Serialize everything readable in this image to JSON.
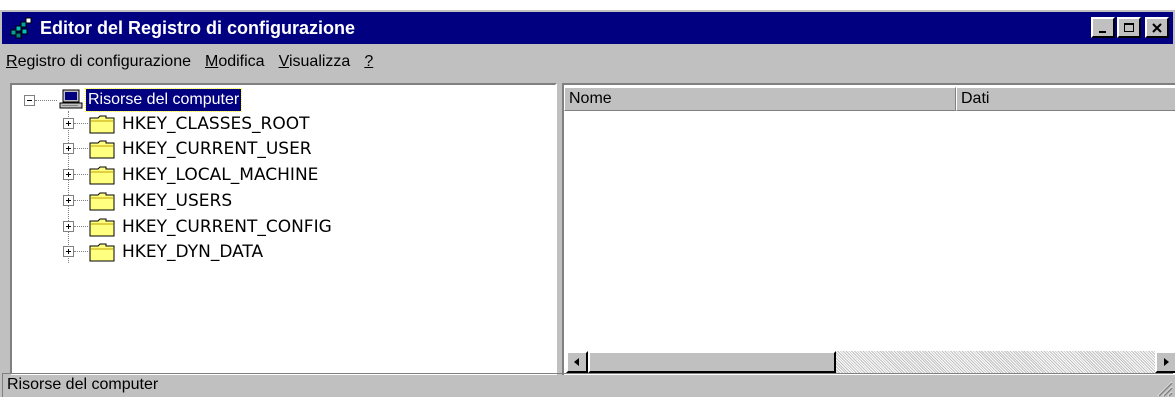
{
  "window": {
    "title": "Editor del Registro di configurazione",
    "icon": "registry-editor-icon"
  },
  "menu": {
    "items": [
      {
        "underline": "R",
        "rest": "egistro di configurazione"
      },
      {
        "underline": "M",
        "rest": "odifica"
      },
      {
        "underline": "V",
        "rest": "isualizza"
      },
      {
        "underline": "?",
        "rest": ""
      }
    ]
  },
  "tree": {
    "root": {
      "label": "Risorse del computer",
      "icon": "computer-icon",
      "expanded": true
    },
    "keys": [
      {
        "label": "HKEY_CLASSES_ROOT",
        "icon": "folder-icon"
      },
      {
        "label": "HKEY_CURRENT_USER",
        "icon": "folder-icon"
      },
      {
        "label": "HKEY_LOCAL_MACHINE",
        "icon": "folder-icon"
      },
      {
        "label": "HKEY_USERS",
        "icon": "folder-icon"
      },
      {
        "label": "HKEY_CURRENT_CONFIG",
        "icon": "folder-icon"
      },
      {
        "label": "HKEY_DYN_DATA",
        "icon": "folder-icon"
      }
    ]
  },
  "list": {
    "columns": [
      "Nome",
      "Dati"
    ]
  },
  "status": {
    "text": "Risorse del computer"
  },
  "colors": {
    "titlebar": "#000080",
    "face": "#c0c0c0",
    "folder": "#ffff80"
  }
}
